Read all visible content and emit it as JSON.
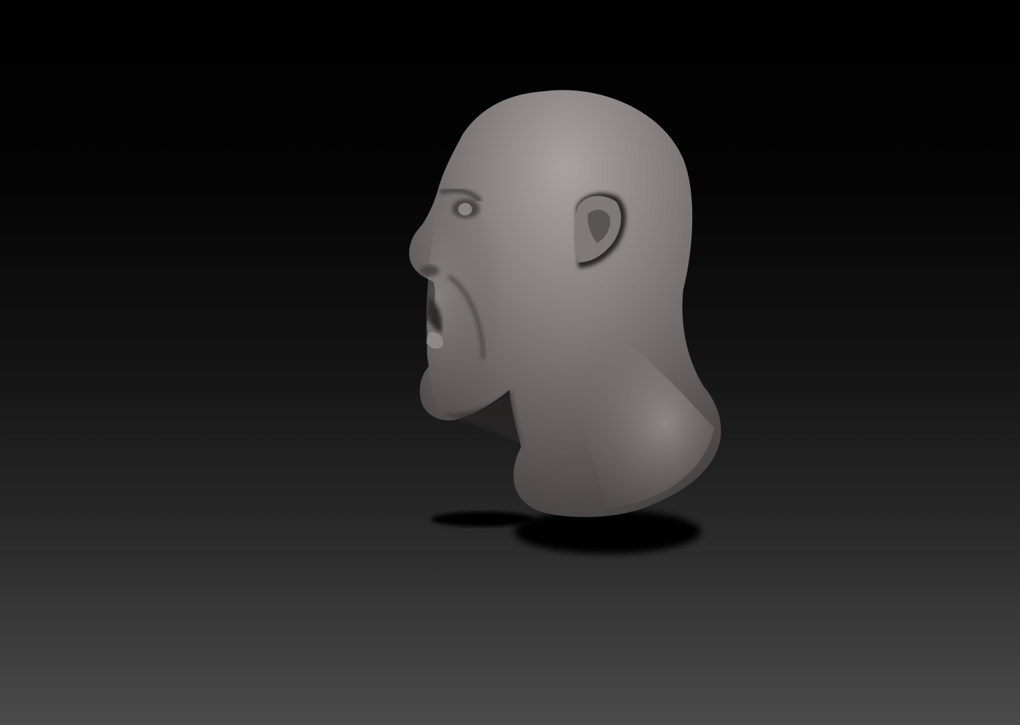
{
  "viewport": {
    "background_top": "#000000",
    "background_bottom": "#4b4b4b",
    "model": {
      "subject": "sculpted-head-bust",
      "material_color": "#7a7474",
      "highlight_color": "#b8b2b2",
      "shadow_color": "#000000"
    }
  }
}
